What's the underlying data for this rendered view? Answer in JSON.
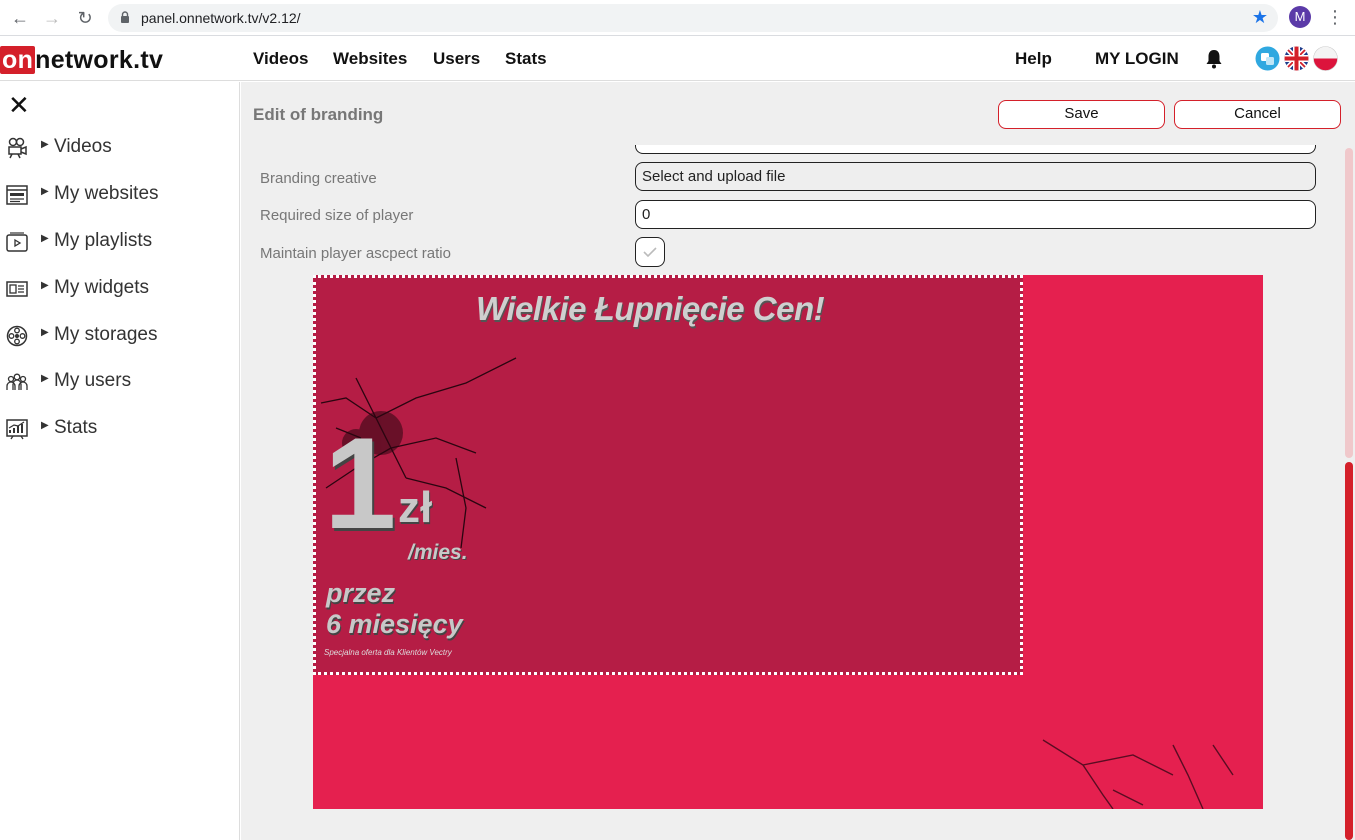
{
  "browser": {
    "url": "panel.onnetwork.tv/v2.12/",
    "profile_initial": "M"
  },
  "header": {
    "logo_prefix": "on",
    "logo_rest": "network.tv",
    "nav": [
      "Videos",
      "Websites",
      "Users",
      "Stats"
    ],
    "help_label": "Help",
    "login_label": "MY LOGIN"
  },
  "sidebar": {
    "items": [
      {
        "label": "Videos",
        "icon": "video-camera-icon"
      },
      {
        "label": "My websites",
        "icon": "website-icon"
      },
      {
        "label": "My playlists",
        "icon": "playlist-icon"
      },
      {
        "label": "My widgets",
        "icon": "widget-icon"
      },
      {
        "label": "My storages",
        "icon": "storage-reel-icon"
      },
      {
        "label": "My users",
        "icon": "users-icon"
      },
      {
        "label": "Stats",
        "icon": "stats-chart-icon"
      }
    ]
  },
  "main": {
    "title": "Edit of branding",
    "save_label": "Save",
    "cancel_label": "Cancel",
    "form": {
      "creative_label": "Branding creative",
      "creative_value": "Select and upload file",
      "size_label": "Required size of player",
      "size_value": "0",
      "ratio_label": "Maintain player ascpect ratio",
      "ratio_checked": true
    },
    "preview": {
      "headline": "Wielkie Łupnięcie Cen!",
      "price_number": "1",
      "price_unit": "zł",
      "price_period": "/mies.",
      "duration_line1": "przez",
      "duration_line2": "6 miesięcy",
      "fine_print": "Specjalna oferta dla Klientów Vectry"
    }
  },
  "colors": {
    "brand_red": "#d4202a",
    "preview_bg": "#e5204f",
    "creative_bg": "#b51d45"
  }
}
